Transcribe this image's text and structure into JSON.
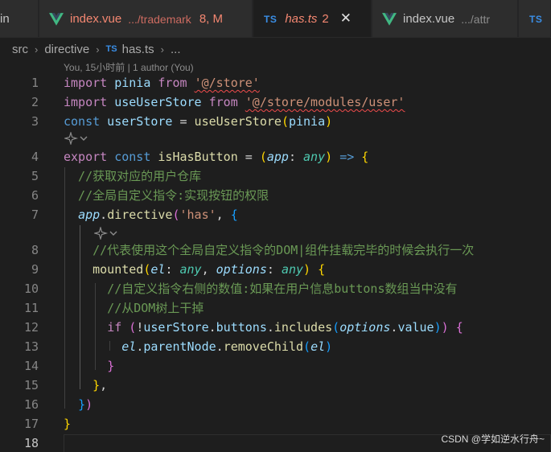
{
  "tabs": [
    {
      "name": "in",
      "kind": "plain"
    },
    {
      "name": "index.vue",
      "desc": ".../trademark",
      "count": "8, M",
      "kind": "vue-error"
    },
    {
      "name": "has.ts",
      "badge": "2",
      "close": "✕",
      "kind": "ts-active"
    },
    {
      "name": "index.vue",
      "desc": ".../attr",
      "kind": "vue"
    },
    {
      "name": "",
      "kind": "ts"
    }
  ],
  "icons": {
    "vue": "vue-icon",
    "ts_label": "TS",
    "close": "close-icon",
    "chevron": "chevron-right-icon",
    "lens": "sparkle-icon"
  },
  "breadcrumb": {
    "items": [
      "src",
      "directive",
      "has.ts",
      "..."
    ]
  },
  "blame": "You, 15小时前 | 1 author (You)",
  "code": {
    "line_numbers": [
      "1",
      "2",
      "3",
      "4",
      "5",
      "6",
      "7",
      "8",
      "9",
      "10",
      "11",
      "12",
      "13",
      "14",
      "15",
      "16",
      "17",
      "18"
    ],
    "lines": [
      [
        {
          "t": "import",
          "c": "kw"
        },
        {
          "t": " pinia ",
          "c": "var"
        },
        {
          "t": "from",
          "c": "kw"
        },
        {
          "t": " ",
          "c": "op"
        },
        {
          "t": "'@/store'",
          "c": "str squig"
        }
      ],
      [
        {
          "t": "import",
          "c": "kw"
        },
        {
          "t": " useUserStore ",
          "c": "var"
        },
        {
          "t": "from",
          "c": "kw"
        },
        {
          "t": " ",
          "c": "op"
        },
        {
          "t": "'@/store/modules/user'",
          "c": "str squig"
        }
      ],
      [
        {
          "t": "const",
          "c": "def"
        },
        {
          "t": " userStore ",
          "c": "var"
        },
        {
          "t": "=",
          "c": "op"
        },
        {
          "t": " useUserStore",
          "c": "fn"
        },
        {
          "t": "(",
          "c": "b1"
        },
        {
          "t": "pinia",
          "c": "var"
        },
        {
          "t": ")",
          "c": "b1"
        }
      ],
      [
        {
          "t": "export",
          "c": "kw"
        },
        {
          "t": " ",
          "c": "op"
        },
        {
          "t": "const",
          "c": "def"
        },
        {
          "t": " isHasButton ",
          "c": "fn"
        },
        {
          "t": "= ",
          "c": "op"
        },
        {
          "t": "(",
          "c": "b1"
        },
        {
          "t": "app",
          "c": "param"
        },
        {
          "t": ": ",
          "c": "op"
        },
        {
          "t": "any",
          "c": "type"
        },
        {
          "t": ")",
          "c": "b1"
        },
        {
          "t": " ",
          "c": "op"
        },
        {
          "t": "=>",
          "c": "def"
        },
        {
          "t": " ",
          "c": "op"
        },
        {
          "t": "{",
          "c": "b1"
        }
      ],
      [
        {
          "t": "  //获取对应的用户仓库",
          "c": "cm"
        }
      ],
      [
        {
          "t": "  //全局自定义指令:实现按钮的权限",
          "c": "cm"
        }
      ],
      [
        {
          "t": "  ",
          "c": "op"
        },
        {
          "t": "app",
          "c": "param"
        },
        {
          "t": ".",
          "c": "op"
        },
        {
          "t": "directive",
          "c": "fn"
        },
        {
          "t": "(",
          "c": "b2"
        },
        {
          "t": "'has'",
          "c": "str"
        },
        {
          "t": ", ",
          "c": "op"
        },
        {
          "t": "{",
          "c": "b3"
        }
      ],
      [
        {
          "t": "    //代表使用这个全局自定义指令的DOM|组件挂载完毕的时候会执行一次",
          "c": "cm"
        }
      ],
      [
        {
          "t": "    ",
          "c": "op"
        },
        {
          "t": "mounted",
          "c": "fn"
        },
        {
          "t": "(",
          "c": "b1"
        },
        {
          "t": "el",
          "c": "param"
        },
        {
          "t": ": ",
          "c": "op"
        },
        {
          "t": "any",
          "c": "type"
        },
        {
          "t": ", ",
          "c": "op"
        },
        {
          "t": "options",
          "c": "param"
        },
        {
          "t": ": ",
          "c": "op"
        },
        {
          "t": "any",
          "c": "type"
        },
        {
          "t": ")",
          "c": "b1"
        },
        {
          "t": " ",
          "c": "op"
        },
        {
          "t": "{",
          "c": "b1"
        }
      ],
      [
        {
          "t": "      //自定义指令右侧的数值:如果在用户信息buttons数组当中没有",
          "c": "cm"
        }
      ],
      [
        {
          "t": "      //从DOM树上干掉",
          "c": "cm"
        }
      ],
      [
        {
          "t": "      ",
          "c": "op"
        },
        {
          "t": "if",
          "c": "kw"
        },
        {
          "t": " ",
          "c": "op"
        },
        {
          "t": "(",
          "c": "b2"
        },
        {
          "t": "!",
          "c": "op"
        },
        {
          "t": "userStore",
          "c": "var"
        },
        {
          "t": ".",
          "c": "op"
        },
        {
          "t": "buttons",
          "c": "var"
        },
        {
          "t": ".",
          "c": "op"
        },
        {
          "t": "includes",
          "c": "fn"
        },
        {
          "t": "(",
          "c": "b3"
        },
        {
          "t": "options",
          "c": "param"
        },
        {
          "t": ".",
          "c": "op"
        },
        {
          "t": "value",
          "c": "var"
        },
        {
          "t": ")",
          "c": "b3"
        },
        {
          "t": ")",
          "c": "b2"
        },
        {
          "t": " ",
          "c": "op"
        },
        {
          "t": "{",
          "c": "b2"
        }
      ],
      [
        {
          "t": "        ",
          "c": "op"
        },
        {
          "t": "el",
          "c": "param"
        },
        {
          "t": ".",
          "c": "op"
        },
        {
          "t": "parentNode",
          "c": "var"
        },
        {
          "t": ".",
          "c": "op"
        },
        {
          "t": "removeChild",
          "c": "fn"
        },
        {
          "t": "(",
          "c": "b3"
        },
        {
          "t": "el",
          "c": "param"
        },
        {
          "t": ")",
          "c": "b3"
        }
      ],
      [
        {
          "t": "      ",
          "c": "op"
        },
        {
          "t": "}",
          "c": "b2"
        }
      ],
      [
        {
          "t": "    ",
          "c": "op"
        },
        {
          "t": "}",
          "c": "b1"
        },
        {
          "t": ",",
          "c": "op"
        }
      ],
      [
        {
          "t": "  ",
          "c": "op"
        },
        {
          "t": "}",
          "c": "b3"
        },
        {
          "t": ")",
          "c": "b2"
        }
      ],
      [
        {
          "t": "}",
          "c": "b1"
        }
      ],
      []
    ]
  },
  "watermark": "CSDN @学如逆水行舟~"
}
